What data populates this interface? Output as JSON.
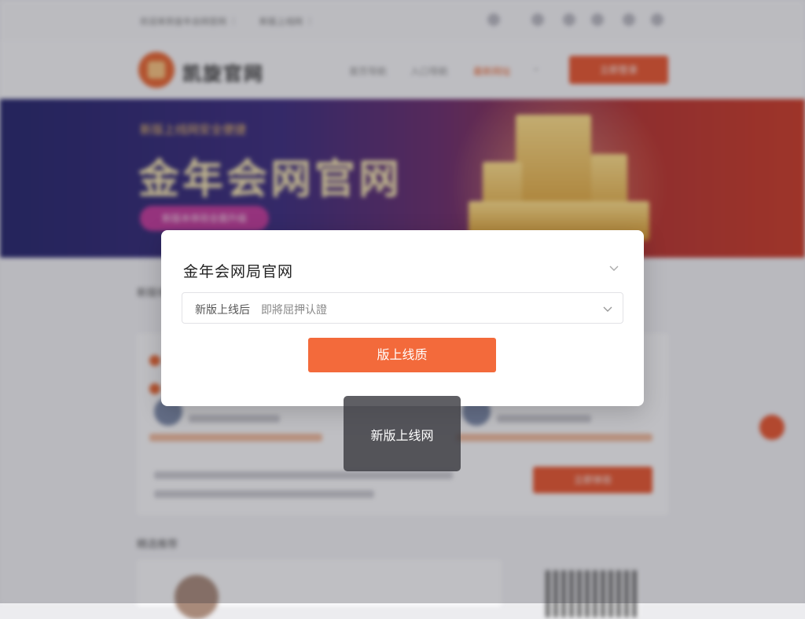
{
  "background": {
    "topbar": {
      "left_text": "欢迎来到金年会网官网 ｜",
      "mid_text": "新版上线网 ｜"
    },
    "header": {
      "logo_text": "凯旋官网",
      "nav": [
        "首页导航",
        "入口导航",
        "最新网址"
      ],
      "cta_label": "立即登录"
    },
    "banner": {
      "subtitle": "新版上线网安全便捷",
      "title": "金年会网官网",
      "pill_label": "新版本体验全面升级"
    },
    "section_title_1": "新版体验",
    "card_button_label": "立即体验",
    "section_title_2": "精选推荐"
  },
  "modal": {
    "title": "金年会网局官网",
    "select_label": "新版上线后",
    "select_value": "即將屈押认證",
    "button_label": "版上线质"
  },
  "toast": {
    "text": "新版上线网"
  },
  "colors": {
    "accent": "#f36a3b",
    "header_cta": "#e8552e",
    "modal_bg": "#ffffff",
    "toast_bg": "#3c3c42"
  },
  "icons": {
    "modal_collapse": "chevron-down-icon",
    "select_dropdown": "chevron-down-icon"
  }
}
